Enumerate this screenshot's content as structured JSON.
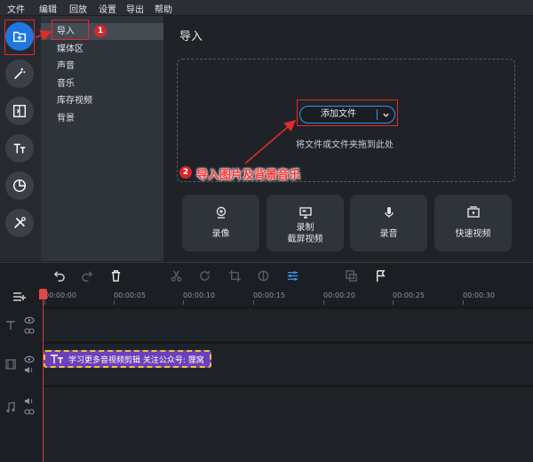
{
  "menu": [
    "文件",
    "编辑",
    "回放",
    "设置",
    "导出",
    "帮助"
  ],
  "categories": [
    "导入",
    "媒体区",
    "声音",
    "音乐",
    "库存视频",
    "背景"
  ],
  "main": {
    "title": "导入",
    "add_button": "添加文件",
    "drop_hint": "将文件或文件夹拖到此处"
  },
  "cards": [
    {
      "icon": "webcam-icon",
      "lines": [
        "录像"
      ]
    },
    {
      "icon": "screen-record-icon",
      "lines": [
        "录制",
        "截屏视频"
      ]
    },
    {
      "icon": "microphone-icon",
      "lines": [
        "录音"
      ]
    },
    {
      "icon": "quick-video-icon",
      "lines": [
        "快速视频"
      ]
    }
  ],
  "annotations": {
    "step1": "1",
    "step2": "2",
    "step2_text": "导入图片及背景音乐"
  },
  "timeline": {
    "ticks": [
      "00:00:00",
      "00:00:05",
      "00:00:10",
      "00:00:15",
      "00:00:20",
      "00:00:25",
      "00:00:30"
    ],
    "clip_text": "学习更多音视频剪辑 关注公众号: 狸窝"
  },
  "colors": {
    "accent": "#1e78e0",
    "annotation": "#e22a2a",
    "clip": "#6d3fb8",
    "clip_border": "#e7c73a",
    "playhead": "#e23b3b"
  }
}
